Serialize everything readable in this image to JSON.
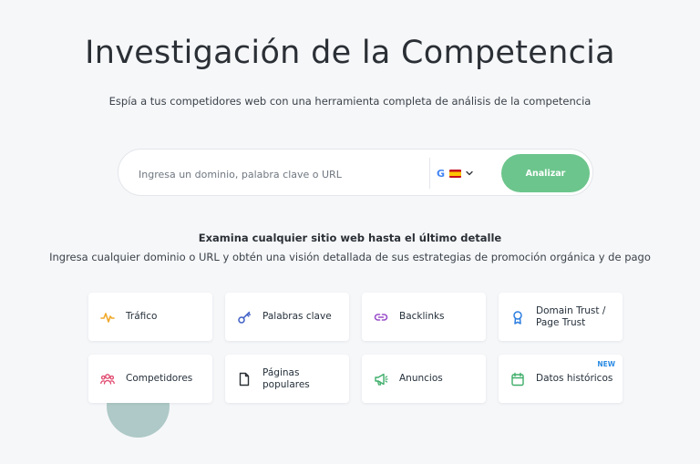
{
  "header": {
    "title": "Investigación de la Competencia",
    "subtitle": "Espía a tus competidores web con una herramienta completa de análisis de la competencia"
  },
  "search": {
    "placeholder": "Ingresa un dominio, palabra clave o URL",
    "value": "",
    "engine_icon": "google-icon",
    "database_flag": "spain-flag-icon",
    "button_label": "Analizar"
  },
  "intro": {
    "heading": "Examina cualquier sitio web hasta el último detalle",
    "text": "Ingresa cualquier dominio o URL y obtén una visión detallada de sus estrategias de promoción orgánica y de pago"
  },
  "features": [
    {
      "label": "Tráfico",
      "icon": "pulse-icon",
      "color": "#f0a92a"
    },
    {
      "label": "Palabras clave",
      "icon": "key-icon",
      "color": "#3d5ec4"
    },
    {
      "label": "Backlinks",
      "icon": "link-icon",
      "color": "#9b4fc9"
    },
    {
      "label": "Domain Trust / Page Trust",
      "icon": "award-icon",
      "color": "#2b7de0"
    },
    {
      "label": "Competidores",
      "icon": "users-icon",
      "color": "#e0456b"
    },
    {
      "label": "Páginas populares",
      "icon": "page-icon",
      "color": "#2b3036"
    },
    {
      "label": "Anuncios",
      "icon": "megaphone-icon",
      "color": "#3fae6a"
    },
    {
      "label": "Datos históricos",
      "icon": "calendar-icon",
      "color": "#3fae6a",
      "badge": "NEW"
    }
  ],
  "colors": {
    "accent_green": "#6cc58c",
    "background": "#f6f7f9",
    "decor_circle": "#aec9c7"
  }
}
